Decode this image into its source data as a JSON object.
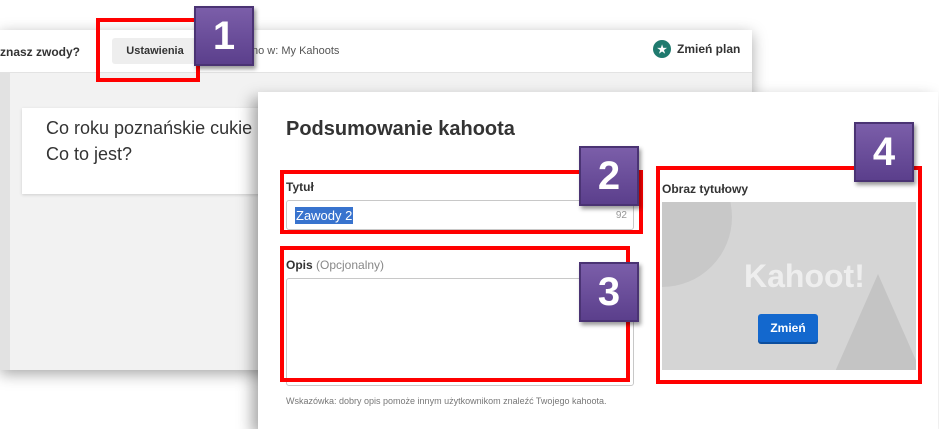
{
  "editor": {
    "title_fragment": "znasz zwody?",
    "settings_label": "Ustawienia",
    "saved_in": "no w: My Kahoots",
    "plan_label": "Zmień plan",
    "plan_icon": "star-icon",
    "question_line1": "Co roku poznańskie cukie",
    "question_line2": "Co to jest?"
  },
  "modal": {
    "heading": "Podsumowanie kahoota",
    "title_label": "Tytuł",
    "title_value": "Zawody 2",
    "title_counter": "92",
    "description_label": "Opis",
    "description_optional": "(Opcjonalny)",
    "hint": "Wskazówka: dobry opis pomoże innym użytkownikom znaleźć Twojego kahoota.",
    "cover_label": "Obraz tytułowy",
    "cover_logo": "Kahoot!",
    "change_button": "Zmień"
  },
  "annotations": [
    "1",
    "2",
    "3",
    "4"
  ],
  "colors": {
    "annotation_red": "#ff0000",
    "badge_purple": "#6b4f9c",
    "button_blue": "#1368ce",
    "plan_green": "#1f7a6e"
  }
}
